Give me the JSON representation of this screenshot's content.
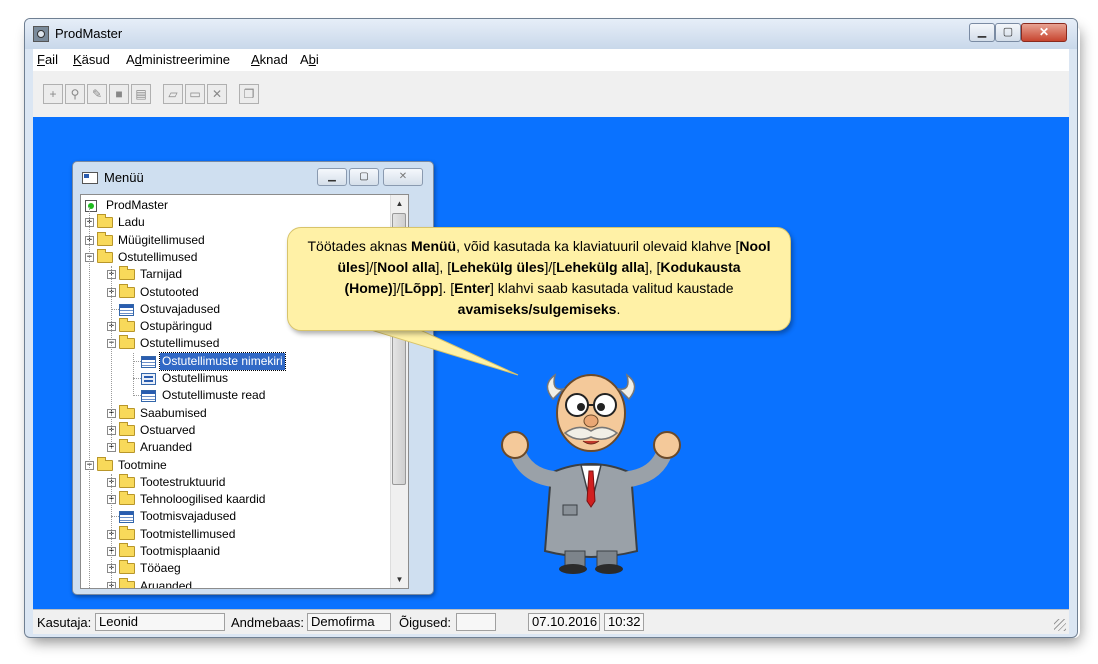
{
  "window": {
    "title": "ProdMaster",
    "min_glyph": "▁",
    "max_glyph": "▢",
    "close_glyph": "✕"
  },
  "menu": [
    {
      "pre": "",
      "acc": "F",
      "post": "ail"
    },
    {
      "pre": "",
      "acc": "K",
      "post": "äsud"
    },
    {
      "pre": "A",
      "acc": "d",
      "post": "ministreerimine"
    },
    {
      "pre": "",
      "acc": "A",
      "post": "knad"
    },
    {
      "pre": "A",
      "acc": "b",
      "post": "i"
    }
  ],
  "toolbar": {
    "icons": [
      "new-record-icon",
      "find-icon",
      "edit-icon",
      "stop-icon",
      "save-icon",
      "open-folder-icon",
      "folder-icon",
      "delete-icon",
      "copy-icon"
    ]
  },
  "menu_window": {
    "title": "Menüü",
    "tree": [
      {
        "label": "ProdMaster",
        "type": "root",
        "level": 0,
        "exp": ""
      },
      {
        "label": "Ladu",
        "type": "folder",
        "level": 1,
        "exp": "+"
      },
      {
        "label": "Müügitellimused",
        "type": "folder",
        "level": 1,
        "exp": "+"
      },
      {
        "label": "Ostutellimused",
        "type": "folder-open",
        "level": 1,
        "exp": "−"
      },
      {
        "label": "Tarnijad",
        "type": "folder",
        "level": 2,
        "exp": "+"
      },
      {
        "label": "Ostutooted",
        "type": "folder",
        "level": 2,
        "exp": "+"
      },
      {
        "label": "Ostuvajadused",
        "type": "grid",
        "level": 2,
        "exp": ""
      },
      {
        "label": "Ostupäringud",
        "type": "folder",
        "level": 2,
        "exp": "+"
      },
      {
        "label": "Ostutellimused",
        "type": "folder-open",
        "level": 2,
        "exp": "−"
      },
      {
        "label": "Ostutellimuste nimekiri",
        "type": "grid",
        "level": 3,
        "exp": "",
        "selected": true
      },
      {
        "label": "Ostutellimus",
        "type": "form",
        "level": 3,
        "exp": ""
      },
      {
        "label": "Ostutellimuste read",
        "type": "grid",
        "level": 3,
        "exp": ""
      },
      {
        "label": "Saabumised",
        "type": "folder",
        "level": 2,
        "exp": "+"
      },
      {
        "label": "Ostuarved",
        "type": "folder",
        "level": 2,
        "exp": "+"
      },
      {
        "label": "Aruanded",
        "type": "folder",
        "level": 2,
        "exp": "+"
      },
      {
        "label": "Tootmine",
        "type": "folder-open",
        "level": 1,
        "exp": "−"
      },
      {
        "label": "Tootestruktuurid",
        "type": "folder",
        "level": 2,
        "exp": "+"
      },
      {
        "label": "Tehnoloogilised kaardid",
        "type": "folder",
        "level": 2,
        "exp": "+"
      },
      {
        "label": "Tootmisvajadused",
        "type": "grid",
        "level": 2,
        "exp": ""
      },
      {
        "label": "Tootmistellimused",
        "type": "folder",
        "level": 2,
        "exp": "+"
      },
      {
        "label": "Tootmisplaanid",
        "type": "folder",
        "level": 2,
        "exp": "+"
      },
      {
        "label": "Tööaeg",
        "type": "folder",
        "level": 2,
        "exp": "+"
      },
      {
        "label": "Aruanded",
        "type": "folder",
        "level": 2,
        "exp": "+"
      }
    ]
  },
  "tip": [
    {
      "t": "Töötades aknas "
    },
    {
      "t": "Menüü",
      "b": true
    },
    {
      "t": ", võid kasutada ka klaviatuuril olevaid klahve ["
    },
    {
      "t": "Nool üles",
      "b": true
    },
    {
      "t": "]/["
    },
    {
      "t": "Nool alla",
      "b": true
    },
    {
      "t": "], ["
    },
    {
      "t": "Lehekülg üles",
      "b": true
    },
    {
      "t": "]/["
    },
    {
      "t": "Lehekülg alla",
      "b": true
    },
    {
      "t": "], ["
    },
    {
      "t": "Kodukausta (Home)",
      "b": true
    },
    {
      "t": "]/["
    },
    {
      "t": "Lõpp",
      "b": true
    },
    {
      "t": "].  ["
    },
    {
      "t": "Enter",
      "b": true
    },
    {
      "t": "] klahvi saab kasutada valitud kaustade "
    },
    {
      "t": "avamiseks/sulgemiseks",
      "b": true
    },
    {
      "t": "."
    }
  ],
  "status": {
    "user_label": "Kasutaja:",
    "user": "Leonid",
    "db_label": "Andmebaas:",
    "db": "Demofirma",
    "rights_label": "Õigused:",
    "rights": "",
    "date": "07.10.2016",
    "time": "10:32"
  },
  "colors": {
    "desktop": "#0a72ff",
    "bubble": "#fff1a6",
    "selection": "#3169c6"
  }
}
